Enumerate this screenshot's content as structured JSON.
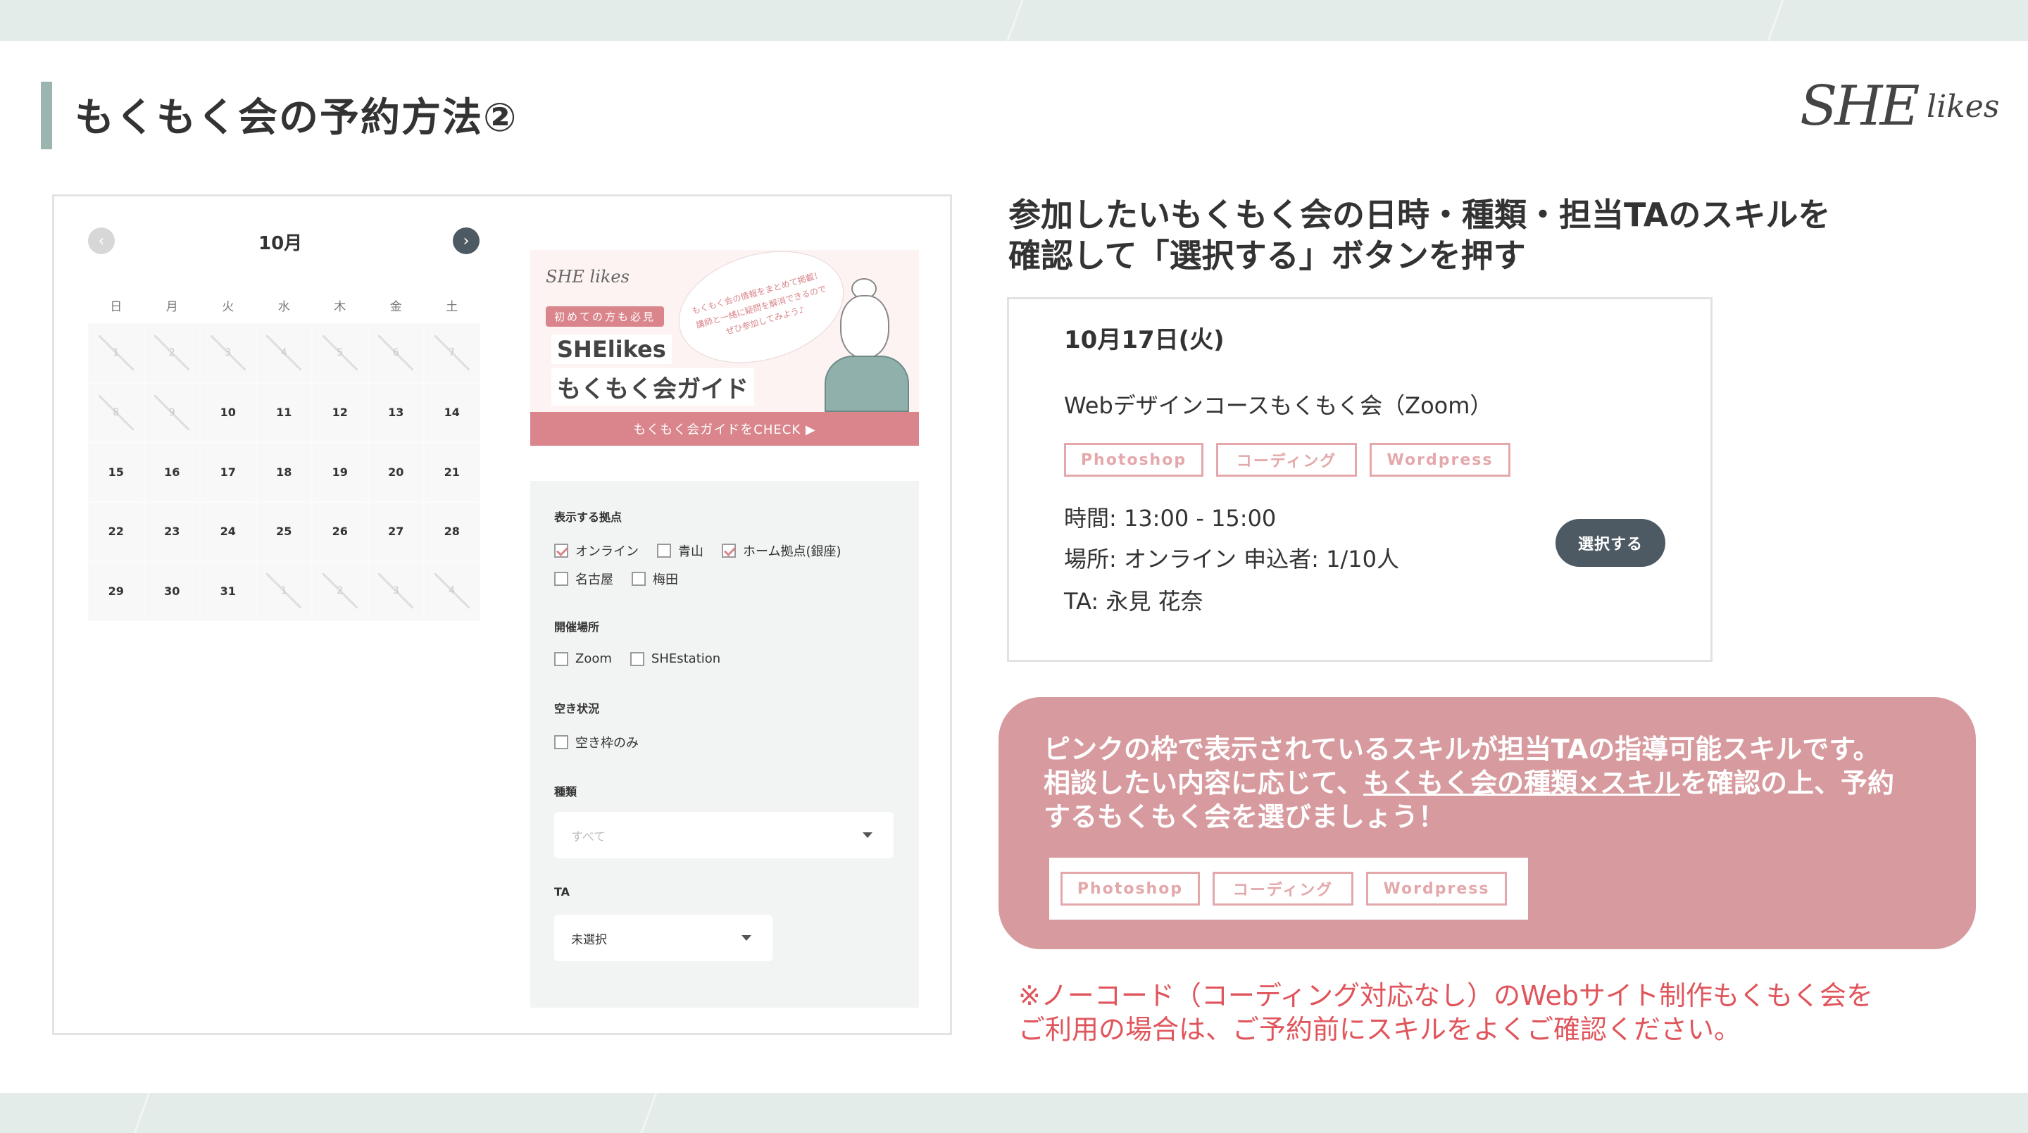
{
  "title": "もくもく会の予約方法②",
  "logo": {
    "she": "SHE",
    "likes": "likes"
  },
  "calendar": {
    "month": "10月",
    "prev_icon": "‹",
    "next_icon": "›",
    "weekdays": [
      "日",
      "月",
      "火",
      "水",
      "木",
      "金",
      "土"
    ],
    "days": [
      {
        "label": "1",
        "state": "past"
      },
      {
        "label": "2",
        "state": "past"
      },
      {
        "label": "3",
        "state": "past"
      },
      {
        "label": "4",
        "state": "past"
      },
      {
        "label": "5",
        "state": "past"
      },
      {
        "label": "6",
        "state": "past"
      },
      {
        "label": "7",
        "state": "past"
      },
      {
        "label": "8",
        "state": "past"
      },
      {
        "label": "9",
        "state": "past"
      },
      {
        "label": "10",
        "state": "normal"
      },
      {
        "label": "11",
        "state": "normal"
      },
      {
        "label": "12",
        "state": "normal"
      },
      {
        "label": "13",
        "state": "normal"
      },
      {
        "label": "14",
        "state": "normal"
      },
      {
        "label": "15",
        "state": "normal"
      },
      {
        "label": "16",
        "state": "normal"
      },
      {
        "label": "17",
        "state": "normal"
      },
      {
        "label": "18",
        "state": "normal"
      },
      {
        "label": "19",
        "state": "normal"
      },
      {
        "label": "20",
        "state": "normal"
      },
      {
        "label": "21",
        "state": "normal"
      },
      {
        "label": "22",
        "state": "normal"
      },
      {
        "label": "23",
        "state": "normal"
      },
      {
        "label": "24",
        "state": "normal"
      },
      {
        "label": "25",
        "state": "normal"
      },
      {
        "label": "26",
        "state": "normal"
      },
      {
        "label": "27",
        "state": "normal"
      },
      {
        "label": "28",
        "state": "normal"
      },
      {
        "label": "29",
        "state": "normal"
      },
      {
        "label": "30",
        "state": "normal"
      },
      {
        "label": "31",
        "state": "normal"
      },
      {
        "label": "1",
        "state": "past"
      },
      {
        "label": "2",
        "state": "past"
      },
      {
        "label": "3",
        "state": "past"
      },
      {
        "label": "4",
        "state": "past"
      }
    ]
  },
  "banner": {
    "mini_logo": "SHE likes",
    "badge": "初めての方も必見",
    "title1": "SHElikes",
    "title2": "もくもく会ガイド",
    "bubble": "もくもく会の情報をまとめて掲載！講師と一緒に疑問を解消できるのでぜひ参加してみよう♪",
    "cta": "もくもく会ガイドをCHECK ▶"
  },
  "filters": {
    "location_label": "表示する拠点",
    "locations": [
      {
        "label": "オンライン",
        "checked": true
      },
      {
        "label": "青山",
        "checked": false
      },
      {
        "label": "ホーム拠点(銀座)",
        "checked": true
      },
      {
        "label": "名古屋",
        "checked": false
      },
      {
        "label": "梅田",
        "checked": false
      }
    ],
    "venue_label": "開催場所",
    "venues": [
      {
        "label": "Zoom",
        "checked": false
      },
      {
        "label": "SHEstation",
        "checked": false
      }
    ],
    "availability_label": "空き状況",
    "availability": [
      {
        "label": "空き枠のみ",
        "checked": false
      }
    ],
    "type_label": "種類",
    "type_placeholder": "すべて",
    "ta_label": "TA",
    "ta_value": "未選択"
  },
  "instruction": {
    "line1": "参加したいもくもく会の日時・種類・担当TAのスキルを",
    "line2": "確認して「選択する」ボタンを押す"
  },
  "session_card": {
    "date": "10月17日(火)",
    "course": "Webデザインコースもくもく会（Zoom）",
    "tags": [
      "Photoshop",
      "コーディング",
      "Wordpress"
    ],
    "time": "時間: 13:00 - 15:00",
    "place": "場所: オンライン 申込者: 1/10人",
    "ta": "TA: 永見 花奈",
    "select_button": "選択する"
  },
  "note": {
    "line1": "ピンクの枠で表示されているスキルが担当TAの指導可能スキルです。",
    "line2_pre": "相談したい内容に応じて、",
    "line2_underline": "もくもく会の種類×スキル",
    "line2_post": "を確認の上、予約",
    "line3": "するもくもく会を選びましょう！",
    "tags": [
      "Photoshop",
      "コーディング",
      "Wordpress"
    ]
  },
  "caution": {
    "line1": "※ノーコード（コーディング対応なし）のWebサイト制作もくもく会を",
    "line2": "ご利用の場合は、ご予約前にスキルをよくご確認ください。"
  },
  "colors": {
    "accent_pink": "#d79a9e",
    "tag_pink": "#e4a8ab",
    "dark_button": "#4d5a63",
    "caution_red": "#e0555c",
    "title_bar": "#9db5b0"
  }
}
